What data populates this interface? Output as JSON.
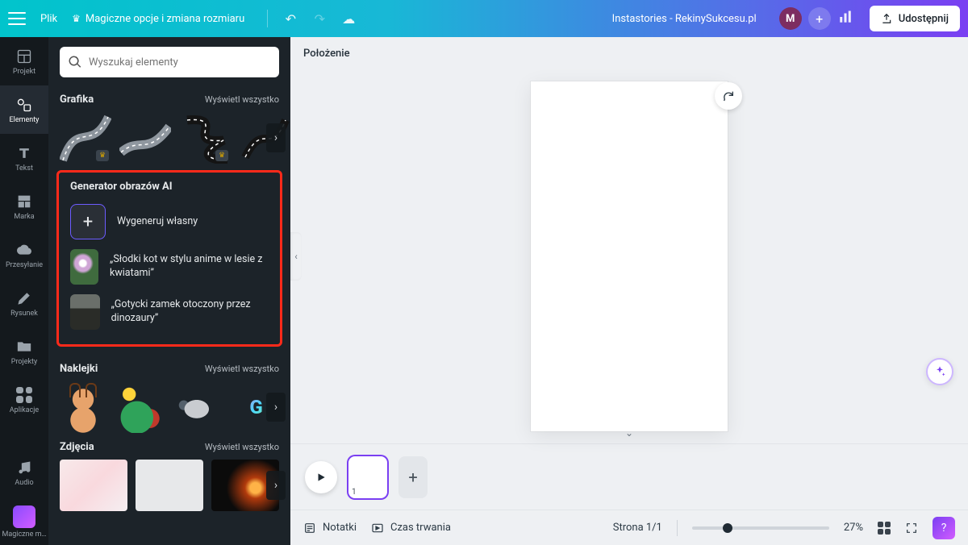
{
  "header": {
    "file": "Plik",
    "magic": "Magiczne opcje i zmiana rozmiaru",
    "docTitle": "Instastories - RekinySukcesu.pl",
    "avatar": "M",
    "share": "Udostępnij"
  },
  "rail": {
    "projekt": "Projekt",
    "elementy": "Elementy",
    "tekst": "Tekst",
    "marka": "Marka",
    "przesylanie": "Przesyłanie",
    "rysunek": "Rysunek",
    "projekty": "Projekty",
    "aplikacje": "Aplikacje",
    "audio": "Audio",
    "magiczne": "Magiczne m…"
  },
  "search": {
    "placeholder": "Wyszukaj elementy"
  },
  "sections": {
    "grafika": {
      "title": "Grafika",
      "all": "Wyświetl wszystko"
    },
    "ai": {
      "title": "Generator obrazów AI",
      "generate": "Wygeneruj własny",
      "suggest1": "„Słodki kot w stylu anime w lesie z kwiatami”",
      "suggest2": "„Gotycki zamek otoczony przez dinozaury”"
    },
    "naklejki": {
      "title": "Naklejki",
      "all": "Wyświetl wszystko"
    },
    "zdjecia": {
      "title": "Zdjęcia",
      "all": "Wyświetl wszystko"
    }
  },
  "contextbar": {
    "position": "Położenie"
  },
  "pagestrip": {
    "pageNum": "1"
  },
  "bottom": {
    "notes": "Notatki",
    "duration": "Czas trwania",
    "pagecount": "Strona 1/1",
    "zoom": "27%"
  },
  "stickers": {
    "go": "G"
  }
}
